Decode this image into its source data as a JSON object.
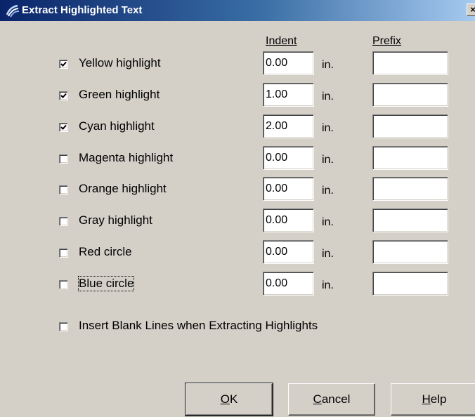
{
  "window": {
    "title": "Extract Highlighted Text",
    "close_glyph": "×",
    "icon": "app-swirl-icon"
  },
  "headers": {
    "indent": "Indent",
    "prefix": "Prefix"
  },
  "unit_label": "in.",
  "options": [
    {
      "label": "Yellow highlight",
      "checked": true,
      "indent": "0.00",
      "prefix": ""
    },
    {
      "label": "Green highlight",
      "checked": true,
      "indent": "1.00",
      "prefix": ""
    },
    {
      "label": "Cyan highlight",
      "checked": true,
      "indent": "2.00",
      "prefix": ""
    },
    {
      "label": "Magenta highlight",
      "checked": false,
      "indent": "0.00",
      "prefix": ""
    },
    {
      "label": "Orange highlight",
      "checked": false,
      "indent": "0.00",
      "prefix": ""
    },
    {
      "label": "Gray highlight",
      "checked": false,
      "indent": "0.00",
      "prefix": ""
    },
    {
      "label": "Red circle",
      "checked": false,
      "indent": "0.00",
      "prefix": ""
    },
    {
      "label": "Blue circle",
      "checked": false,
      "indent": "0.00",
      "prefix": "",
      "focused": true
    }
  ],
  "insert_blank_lines": {
    "label": "Insert Blank Lines when Extracting Highlights",
    "checked": false
  },
  "buttons": {
    "ok": {
      "pre": "",
      "mnemonic": "O",
      "post": "K"
    },
    "cancel": {
      "pre": "",
      "mnemonic": "C",
      "post": "ancel"
    },
    "help": {
      "pre": "",
      "mnemonic": "H",
      "post": "elp"
    }
  }
}
